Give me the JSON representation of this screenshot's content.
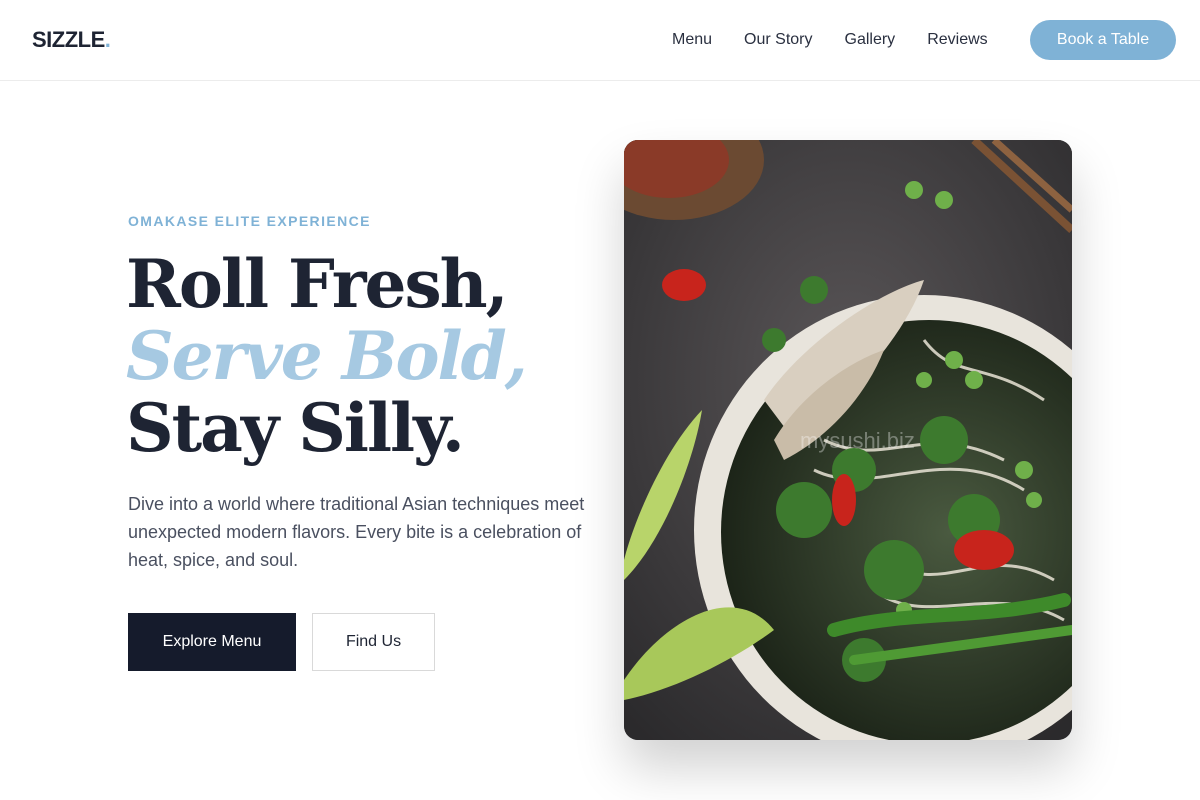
{
  "brand": {
    "name": "SIZZLE",
    "dot": "."
  },
  "nav": {
    "items": [
      {
        "label": "Menu"
      },
      {
        "label": "Our Story"
      },
      {
        "label": "Gallery"
      },
      {
        "label": "Reviews"
      }
    ],
    "cta": "Book a Table"
  },
  "hero": {
    "eyebrow": "OMAKASE ELITE EXPERIENCE",
    "headline": {
      "line1": "Roll Fresh,",
      "line2": "Serve Bold,",
      "line3": "Stay Silly."
    },
    "lede": "Dive into a world where traditional Asian techniques meet unexpected modern flavors. Every bite is a celebration of heat, spice, and soul.",
    "primary_cta": "Explore Menu",
    "secondary_cta": "Find Us",
    "image_watermark": "mysushi.biz"
  },
  "colors": {
    "accent": "#7fb2d6",
    "accent_light": "#a6c9e2",
    "ink": "#1e2433",
    "button_dark": "#151b2c"
  }
}
